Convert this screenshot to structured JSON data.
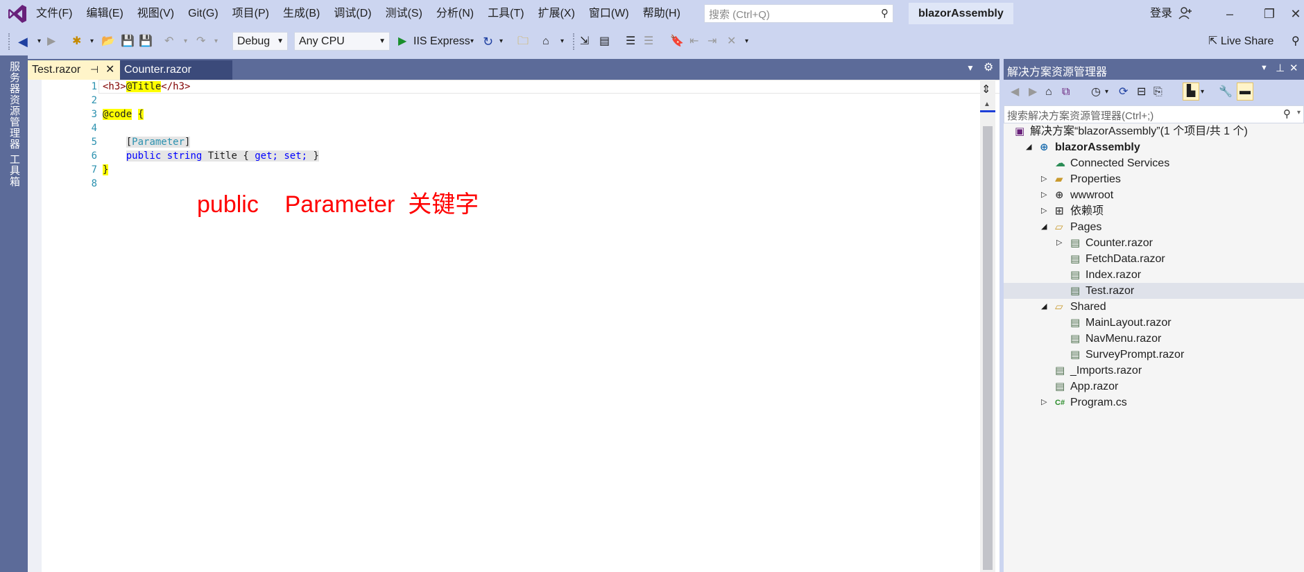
{
  "menubar": {
    "items": [
      "文件(F)",
      "编辑(E)",
      "视图(V)",
      "Git(G)",
      "项目(P)",
      "生成(B)",
      "调试(D)",
      "测试(S)",
      "分析(N)",
      "工具(T)",
      "扩展(X)",
      "窗口(W)",
      "帮助(H)"
    ],
    "search_placeholder": "搜索 (Ctrl+Q)",
    "solution_name": "blazorAssembly",
    "login": "登录",
    "window_controls": [
      "minimize-icon",
      "restore-icon",
      "close-icon"
    ]
  },
  "toolbar": {
    "config": "Debug",
    "platform": "Any CPU",
    "run_target": "IIS Express",
    "live_share": "Live Share"
  },
  "side_tabs": [
    "服务器资源管理器",
    "工具箱"
  ],
  "editor": {
    "tabs": [
      {
        "label": "Test.razor",
        "active": true
      },
      {
        "label": "Counter.razor",
        "active": false
      }
    ],
    "line_numbers": [
      "1",
      "2",
      "3",
      "4",
      "5",
      "6",
      "7",
      "8"
    ],
    "code": {
      "l1_open": "<h3>",
      "l1_var": "@Title",
      "l1_close": "</h3>",
      "l3_code": "@code",
      "l3_brace": "{",
      "l5_open": "[",
      "l5_attr": "Parameter",
      "l5_close": "]",
      "l6_public": "public",
      "l6_string": "string",
      "l6_name": "Title",
      "l6_ob": "{",
      "l6_get": "get;",
      "l6_set": "set;",
      "l6_cb": "}",
      "l7_brace": "}"
    },
    "annotation": "public    Parameter  关键字"
  },
  "solution_explorer": {
    "title": "解决方案资源管理器",
    "search_placeholder": "搜索解决方案资源管理器(Ctrl+;)",
    "tree": [
      {
        "label": "解决方案“blazorAssembly”(1 个项目/共 1 个)",
        "level": 0,
        "expander": "",
        "icon": "solution-icon"
      },
      {
        "label": "blazorAssembly",
        "level": 0,
        "expander": "expanded",
        "icon": "web-project-icon",
        "bold": true
      },
      {
        "label": "Connected Services",
        "level": 1,
        "expander": "",
        "icon": "connected-services-icon"
      },
      {
        "label": "Properties",
        "level": 1,
        "expander": "collapsed",
        "icon": "folder-wrench-icon"
      },
      {
        "label": "wwwroot",
        "level": 1,
        "expander": "collapsed",
        "icon": "globe-icon"
      },
      {
        "label": "依赖项",
        "level": 1,
        "expander": "collapsed",
        "icon": "dependencies-icon"
      },
      {
        "label": "Pages",
        "level": 1,
        "expander": "expanded",
        "icon": "folder-open-icon"
      },
      {
        "label": "Counter.razor",
        "level": 2,
        "expander": "collapsed",
        "icon": "razor-file-icon"
      },
      {
        "label": "FetchData.razor",
        "level": 2,
        "expander": "",
        "icon": "razor-file-icon"
      },
      {
        "label": "Index.razor",
        "level": 2,
        "expander": "",
        "icon": "razor-file-icon"
      },
      {
        "label": "Test.razor",
        "level": 2,
        "expander": "",
        "icon": "razor-file-icon",
        "selected": true
      },
      {
        "label": "Shared",
        "level": 1,
        "expander": "expanded",
        "icon": "folder-open-icon"
      },
      {
        "label": "MainLayout.razor",
        "level": 2,
        "expander": "",
        "icon": "razor-file-icon"
      },
      {
        "label": "NavMenu.razor",
        "level": 2,
        "expander": "",
        "icon": "razor-file-icon"
      },
      {
        "label": "SurveyPrompt.razor",
        "level": 2,
        "expander": "",
        "icon": "razor-file-icon"
      },
      {
        "label": "_Imports.razor",
        "level": 1,
        "expander": "",
        "icon": "razor-file-icon"
      },
      {
        "label": "App.razor",
        "level": 1,
        "expander": "",
        "icon": "razor-file-icon"
      },
      {
        "label": "Program.cs",
        "level": 1,
        "expander": "collapsed",
        "icon": "csharp-file-icon"
      }
    ]
  },
  "colors": {
    "chrome": "#ccd5f0",
    "panel_header": "#5c6b99",
    "active_tab": "#fff4c9",
    "annotation": "#ff0000"
  }
}
